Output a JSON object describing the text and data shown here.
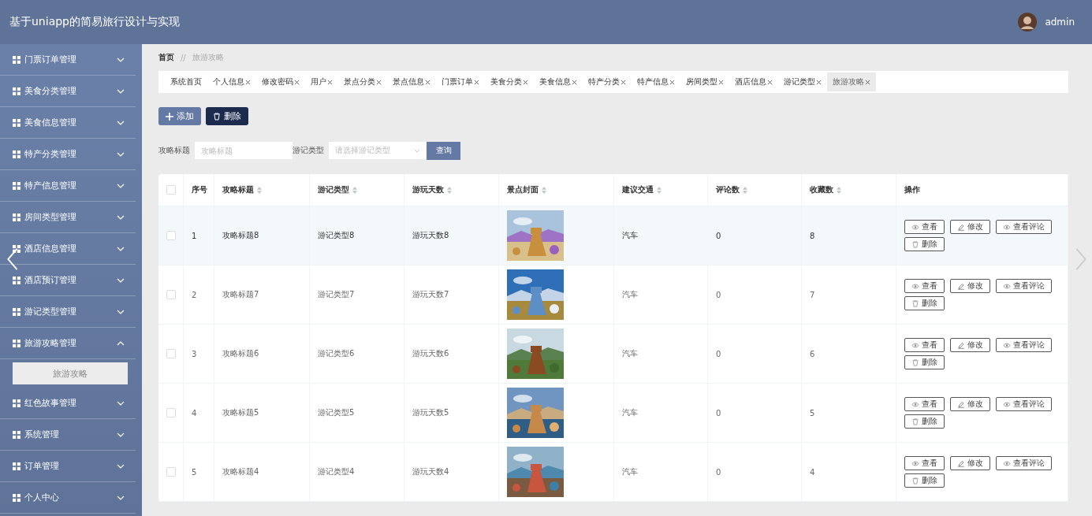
{
  "header": {
    "title": "基于uniapp的简易旅行设计与实现",
    "user": "admin"
  },
  "sidebar": {
    "items": [
      {
        "label": "门票订单管理",
        "expanded": false
      },
      {
        "label": "美食分类管理",
        "expanded": false
      },
      {
        "label": "美食信息管理",
        "expanded": false
      },
      {
        "label": "特产分类管理",
        "expanded": false
      },
      {
        "label": "特产信息管理",
        "expanded": false
      },
      {
        "label": "房间类型管理",
        "expanded": false
      },
      {
        "label": "酒店信息管理",
        "expanded": false
      },
      {
        "label": "酒店预订管理",
        "expanded": false
      },
      {
        "label": "游记类型管理",
        "expanded": false
      },
      {
        "label": "旅游攻略管理",
        "expanded": true,
        "children": [
          {
            "label": "旅游攻略",
            "selected": true
          }
        ]
      },
      {
        "label": "红色故事管理",
        "expanded": false
      },
      {
        "label": "系统管理",
        "expanded": false
      },
      {
        "label": "订单管理",
        "expanded": false
      },
      {
        "label": "个人中心",
        "expanded": false
      }
    ]
  },
  "breadcrumb": {
    "home": "首页",
    "separator": "//",
    "current": "旅游攻略"
  },
  "tabs": [
    {
      "label": "系统首页",
      "closable": false,
      "selected": false
    },
    {
      "label": "个人信息",
      "closable": true,
      "selected": false
    },
    {
      "label": "修改密码",
      "closable": true,
      "selected": false
    },
    {
      "label": "用户",
      "closable": true,
      "selected": false
    },
    {
      "label": "景点分类",
      "closable": true,
      "selected": false
    },
    {
      "label": "景点信息",
      "closable": true,
      "selected": false
    },
    {
      "label": "门票订单",
      "closable": true,
      "selected": false
    },
    {
      "label": "美食分类",
      "closable": true,
      "selected": false
    },
    {
      "label": "美食信息",
      "closable": true,
      "selected": false
    },
    {
      "label": "特产分类",
      "closable": true,
      "selected": false
    },
    {
      "label": "特产信息",
      "closable": true,
      "selected": false
    },
    {
      "label": "房间类型",
      "closable": true,
      "selected": false
    },
    {
      "label": "酒店信息",
      "closable": true,
      "selected": false
    },
    {
      "label": "游记类型",
      "closable": true,
      "selected": false
    },
    {
      "label": "旅游攻略",
      "closable": true,
      "selected": true
    }
  ],
  "toolbar": [
    {
      "label": "添加",
      "kind": "add"
    },
    {
      "label": "删除",
      "kind": "delete"
    }
  ],
  "search": {
    "title_label": "攻略标题",
    "title_placeholder": "攻略标题",
    "type_label": "游记类型",
    "type_placeholder": "请选择游记类型",
    "button": "查询"
  },
  "table": {
    "all_checked": false,
    "columns": [
      {
        "label": "序号",
        "sortable": false
      },
      {
        "label": "攻略标题",
        "sortable": true
      },
      {
        "label": "游记类型",
        "sortable": true
      },
      {
        "label": "游玩天数",
        "sortable": true
      },
      {
        "label": "景点封面",
        "sortable": true
      },
      {
        "label": "建议交通",
        "sortable": true
      },
      {
        "label": "评论数",
        "sortable": true
      },
      {
        "label": "收藏数",
        "sortable": true
      },
      {
        "label": "操作",
        "sortable": false
      }
    ],
    "rows": [
      {
        "index": "1",
        "title": "攻略标题8",
        "type": "游记类型8",
        "days": "游玩天数8",
        "cover": {
          "kind": "picture"
        },
        "transport": "汽车",
        "comments": "0",
        "favorites": "8",
        "checked": false,
        "hovered": true,
        "actions": [
          {
            "label": "查看",
            "kind": "view"
          },
          {
            "label": "修改",
            "kind": "edit"
          },
          {
            "label": "查看评论",
            "kind": "view"
          },
          {
            "label": "删除",
            "kind": "delete"
          }
        ]
      },
      {
        "index": "2",
        "title": "攻略标题7",
        "type": "游记类型7",
        "days": "游玩天数7",
        "cover": {
          "kind": "picture"
        },
        "transport": "汽车",
        "comments": "0",
        "favorites": "7",
        "checked": false,
        "hovered": false,
        "actions": [
          {
            "label": "查看",
            "kind": "view"
          },
          {
            "label": "修改",
            "kind": "edit"
          },
          {
            "label": "查看评论",
            "kind": "view"
          },
          {
            "label": "删除",
            "kind": "delete"
          }
        ]
      },
      {
        "index": "3",
        "title": "攻略标题6",
        "type": "游记类型6",
        "days": "游玩天数6",
        "cover": {
          "kind": "picture"
        },
        "transport": "汽车",
        "comments": "0",
        "favorites": "6",
        "checked": false,
        "hovered": false,
        "actions": [
          {
            "label": "查看",
            "kind": "view"
          },
          {
            "label": "修改",
            "kind": "edit"
          },
          {
            "label": "查看评论",
            "kind": "view"
          },
          {
            "label": "删除",
            "kind": "delete"
          }
        ]
      },
      {
        "index": "4",
        "title": "攻略标题5",
        "type": "游记类型5",
        "days": "游玩天数5",
        "cover": {
          "kind": "picture"
        },
        "transport": "汽车",
        "comments": "0",
        "favorites": "5",
        "checked": false,
        "hovered": false,
        "actions": [
          {
            "label": "查看",
            "kind": "view"
          },
          {
            "label": "修改",
            "kind": "edit"
          },
          {
            "label": "查看评论",
            "kind": "view"
          },
          {
            "label": "删除",
            "kind": "delete"
          }
        ]
      },
      {
        "index": "5",
        "title": "攻略标题4",
        "type": "游记类型4",
        "days": "游玩天数4",
        "cover": {
          "kind": "picture"
        },
        "transport": "汽车",
        "comments": "0",
        "favorites": "4",
        "checked": false,
        "hovered": false,
        "actions": [
          {
            "label": "查看",
            "kind": "view"
          },
          {
            "label": "修改",
            "kind": "edit"
          },
          {
            "label": "查看评论",
            "kind": "view"
          },
          {
            "label": "删除",
            "kind": "delete"
          }
        ]
      }
    ]
  }
}
